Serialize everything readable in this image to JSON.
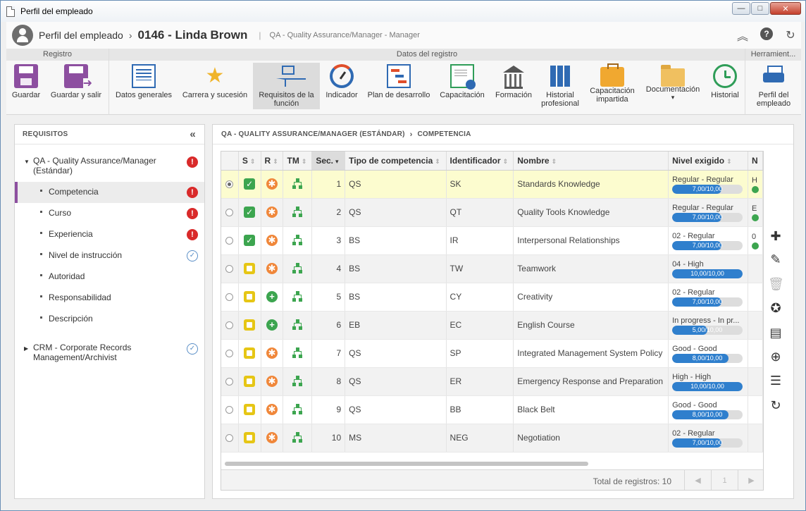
{
  "window": {
    "title": "Perfil del empleado",
    "controls": {
      "minimize": "—",
      "maximize": "□",
      "close": "✕"
    }
  },
  "header": {
    "module": "Perfil del empleado",
    "separator": "›",
    "record": "0146 - Linda Brown",
    "bar": "|",
    "subtitle": "QA - Quality Assurance/Manager - Manager",
    "tools": {
      "collapse": "︽",
      "help": "?",
      "refresh": "↻"
    }
  },
  "ribbon": {
    "groups": [
      "Registro",
      "Datos del registro",
      "Herramient..."
    ],
    "buttons": [
      {
        "label": "Guardar",
        "icon": "save-icon"
      },
      {
        "label": "Guardar y salir",
        "icon": "save-exit-icon"
      },
      {
        "label": "Datos generales",
        "icon": "general-data-icon"
      },
      {
        "label": "Carrera y sucesión",
        "icon": "career-star-icon"
      },
      {
        "label": "Requisitos de la función",
        "icon": "requirements-tree-icon"
      },
      {
        "label": "Indicador",
        "icon": "gauge-icon"
      },
      {
        "label": "Plan de desarrollo",
        "icon": "development-plan-icon"
      },
      {
        "label": "Capacitación",
        "icon": "certificate-icon"
      },
      {
        "label": "Formación",
        "icon": "institution-icon"
      },
      {
        "label": "Historial profesional",
        "icon": "binders-icon"
      },
      {
        "label": "Capacitación impartida",
        "icon": "briefcase-icon"
      },
      {
        "label": "Documentación",
        "icon": "folder-icon",
        "dropdown": "▾"
      },
      {
        "label": "Historial",
        "icon": "history-clock-icon"
      },
      {
        "label": "Perfil del empleado",
        "icon": "print-icon"
      }
    ]
  },
  "left_panel": {
    "title": "REQUISITOS",
    "collapse_glyph": "«",
    "tree": [
      {
        "label": "QA - Quality Assurance/Manager (Estándar)",
        "status": "error",
        "expanded": true,
        "caret": "▼"
      },
      {
        "label": "Competencia",
        "status": "error",
        "selected": true
      },
      {
        "label": "Curso",
        "status": "error"
      },
      {
        "label": "Experiencia",
        "status": "error"
      },
      {
        "label": "Nivel de instrucción",
        "status": "ok"
      },
      {
        "label": "Autoridad",
        "status": "none"
      },
      {
        "label": "Responsabilidad",
        "status": "none"
      },
      {
        "label": "Descripción",
        "status": "none"
      },
      {
        "label": "CRM - Corporate Records Management/Archivist",
        "status": "ok",
        "expanded": false,
        "caret": "▶"
      }
    ],
    "status_glyphs": {
      "error": "!",
      "ok": "✓"
    }
  },
  "breadcrumb": {
    "parent": "QA - QUALITY ASSURANCE/MANAGER (ESTÁNDAR)",
    "chevron": "›",
    "current": "COMPETENCIA"
  },
  "grid": {
    "columns": {
      "s": "S",
      "r": "R",
      "tm": "TM",
      "sec": "Sec.",
      "type": "Tipo de competencia",
      "id": "Identificador",
      "name": "Nombre",
      "level": "Nivel exigido",
      "next": "N"
    },
    "sort_glyphs": {
      "default": "⇕",
      "desc": "▾"
    },
    "rows": [
      {
        "sec": "1",
        "type": "QS",
        "id": "SK",
        "name": "Standards Knowledge",
        "s": "green",
        "r": "orange",
        "level_text": "Regular - Regular",
        "level_label": "7,00/10,00",
        "level_pct": 70,
        "next": "H",
        "selected": true
      },
      {
        "sec": "2",
        "type": "QS",
        "id": "QT",
        "name": "Quality Tools Knowledge",
        "s": "green",
        "r": "orange",
        "level_text": "Regular - Regular",
        "level_label": "7,00/10,00",
        "level_pct": 70,
        "next": "E"
      },
      {
        "sec": "3",
        "type": "BS",
        "id": "IR",
        "name": "Interpersonal Relationships",
        "s": "green",
        "r": "orange",
        "level_text": "02 - Regular",
        "level_label": "7,00/10,00",
        "level_pct": 70,
        "next": "0"
      },
      {
        "sec": "4",
        "type": "BS",
        "id": "TW",
        "name": "Teamwork",
        "s": "yellow",
        "r": "orange",
        "level_text": "04 - High",
        "level_label": "10,00/10,00",
        "level_pct": 100,
        "next": ""
      },
      {
        "sec": "5",
        "type": "BS",
        "id": "CY",
        "name": "Creativity",
        "s": "yellow",
        "r": "green",
        "level_text": "02 - Regular",
        "level_label": "7,00/10,00",
        "level_pct": 70,
        "next": ""
      },
      {
        "sec": "6",
        "type": "EB",
        "id": "EC",
        "name": "English Course",
        "s": "yellow",
        "r": "green",
        "level_text": "In progress - In pr...",
        "level_label": "5,00/10,00",
        "level_pct": 50,
        "next": ""
      },
      {
        "sec": "7",
        "type": "QS",
        "id": "SP",
        "name": "Integrated Management System Policy",
        "s": "yellow",
        "r": "orange",
        "level_text": "Good - Good",
        "level_label": "8,00/10,00",
        "level_pct": 80,
        "next": ""
      },
      {
        "sec": "8",
        "type": "QS",
        "id": "ER",
        "name": "Emergency Response and Preparation",
        "s": "yellow",
        "r": "orange",
        "level_text": "High - High",
        "level_label": "10,00/10,00",
        "level_pct": 100,
        "next": ""
      },
      {
        "sec": "9",
        "type": "QS",
        "id": "BB",
        "name": "Black Belt",
        "s": "yellow",
        "r": "orange",
        "level_text": "Good - Good",
        "level_label": "8,00/10,00",
        "level_pct": 80,
        "next": ""
      },
      {
        "sec": "10",
        "type": "MS",
        "id": "NEG",
        "name": "Negotiation",
        "s": "yellow",
        "r": "orange",
        "level_text": "02 - Regular",
        "level_label": "7,00/10,00",
        "level_pct": 70,
        "next": ""
      }
    ],
    "footer": {
      "total": "Total de registros: 10",
      "prev": "◀",
      "page": "1",
      "next": "▶"
    }
  },
  "side_tools": [
    {
      "name": "add-icon",
      "glyph": "✚",
      "disabled": false
    },
    {
      "name": "edit-icon",
      "glyph": "✎",
      "disabled": false
    },
    {
      "name": "delete-icon",
      "glyph": "🗑",
      "disabled": true
    },
    {
      "name": "award-icon",
      "glyph": "✪",
      "disabled": false
    },
    {
      "name": "certificate-icon",
      "glyph": "▤",
      "disabled": false
    },
    {
      "name": "target-icon",
      "glyph": "⊕",
      "disabled": false
    },
    {
      "name": "list-icon",
      "glyph": "☰",
      "disabled": false
    },
    {
      "name": "refresh-icon",
      "glyph": "↻",
      "disabled": false
    }
  ],
  "colors": {
    "accent": "#8d4fa0",
    "bar_fill": "#2f7fcd",
    "error": "#d92a2a",
    "ok_green": "#3ca54f",
    "pending_yellow": "#e6c615",
    "orange": "#f0873a"
  }
}
